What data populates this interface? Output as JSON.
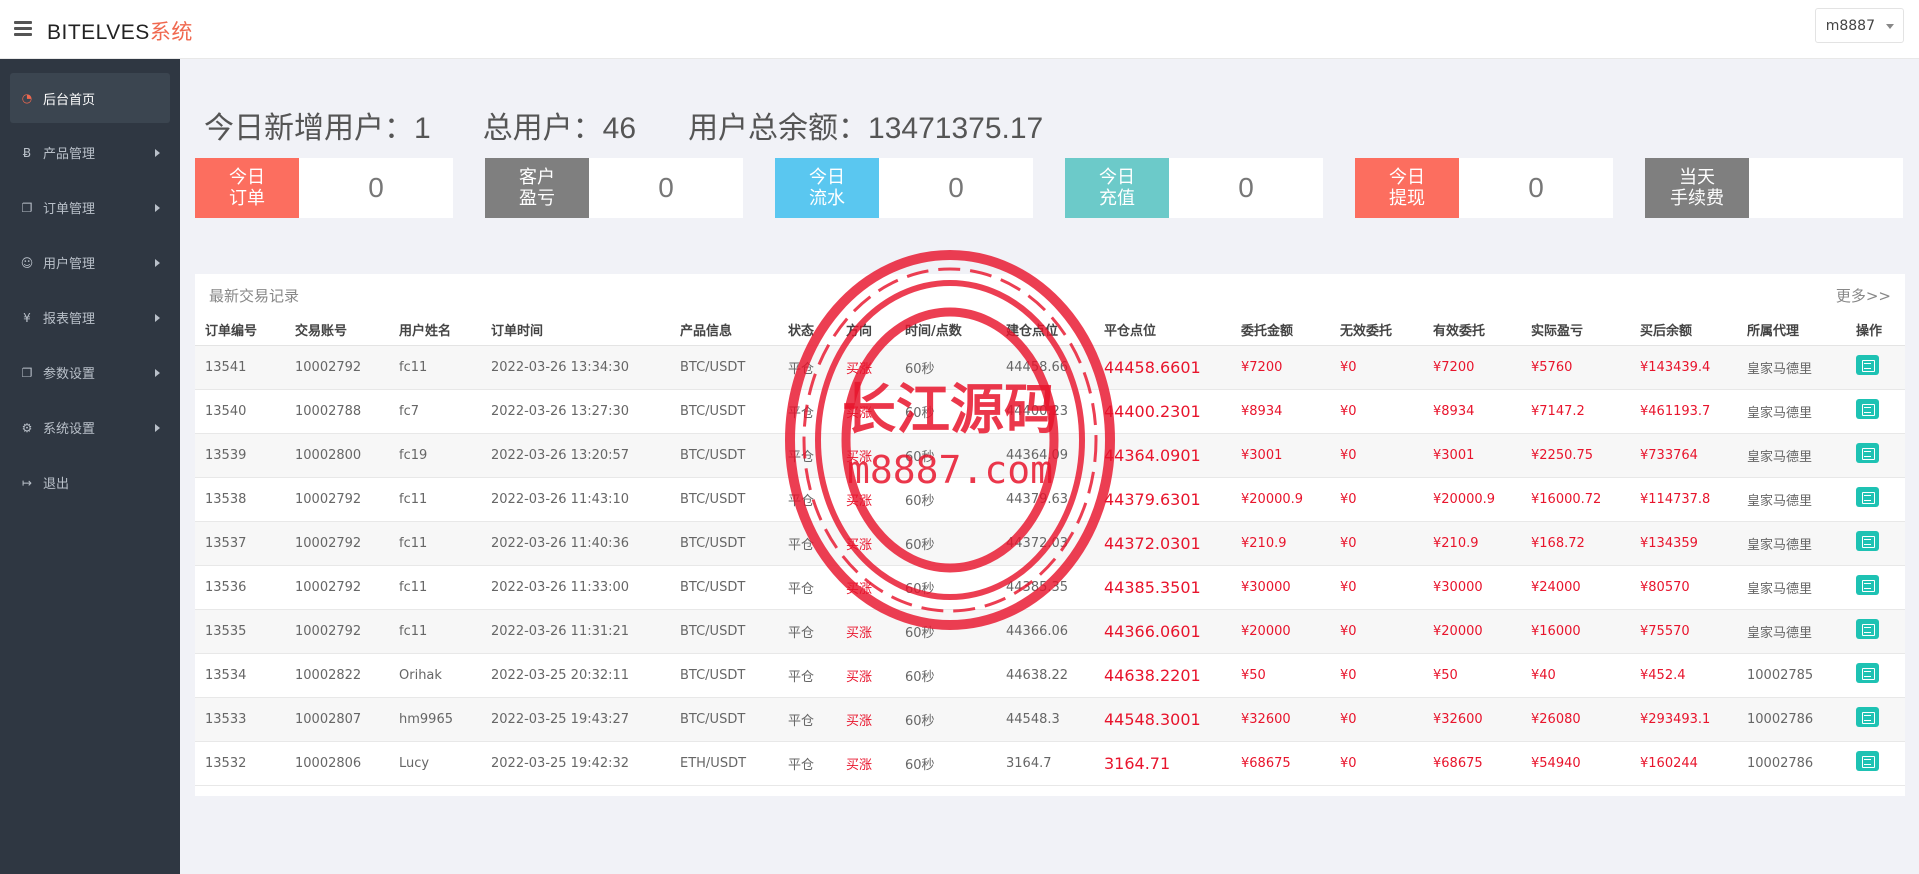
{
  "header": {
    "brand_main": "BITELVES",
    "brand_accent": "系统",
    "user": "m8887"
  },
  "sidebar": {
    "items": [
      {
        "label": "后台首页",
        "icon": "dashboard-icon",
        "active": true
      },
      {
        "label": "产品管理",
        "icon": "bitcoin-icon",
        "active": false
      },
      {
        "label": "订单管理",
        "icon": "copy-icon",
        "active": false
      },
      {
        "label": "用户管理",
        "icon": "user-icon",
        "active": false
      },
      {
        "label": "报表管理",
        "icon": "yen-icon",
        "active": false
      },
      {
        "label": "参数设置",
        "icon": "copy-icon",
        "active": false
      },
      {
        "label": "系统设置",
        "icon": "gears-icon",
        "active": false
      },
      {
        "label": "退出",
        "icon": "sign-out-icon",
        "active": false
      }
    ]
  },
  "summary": {
    "new_users": "今日新增用户：1",
    "total_users": "总用户：46",
    "total_balance": "用户总余额：13471375.17"
  },
  "stats": [
    {
      "label": "今日\n订单",
      "value": "0",
      "color": "#fc6e5f"
    },
    {
      "label": "客户\n盈亏",
      "value": "0",
      "color": "#7f7f7f"
    },
    {
      "label": "今日\n流水",
      "value": "0",
      "color": "#5ac7f0"
    },
    {
      "label": "今日\n充值",
      "value": "0",
      "color": "#6ccac9"
    },
    {
      "label": "今日\n提现",
      "value": "0",
      "color": "#fc6e5f"
    },
    {
      "label": "当天\n手续费",
      "value": "",
      "color": "#7f7f7f"
    }
  ],
  "table": {
    "title": "最新交易记录",
    "more": "更多>>",
    "columns": [
      "订单编号",
      "交易账号",
      "用户姓名",
      "订单时间",
      "产品信息",
      "状态",
      "方向",
      "时间/点数",
      "建仓点位",
      "平仓点位",
      "委托金额",
      "无效委托",
      "有效委托",
      "实际盈亏",
      "买后余额",
      "所属代理",
      "操作"
    ],
    "rows": [
      [
        "13541",
        "10002792",
        "fc11",
        "2022-03-26 13:34:30",
        "BTC/USDT",
        "平仓",
        "买涨",
        "60秒",
        "44458.66",
        "44458.6601",
        "¥7200",
        "¥0",
        "¥7200",
        "¥5760",
        "¥143439.4",
        "皇家马德里"
      ],
      [
        "13540",
        "10002788",
        "fc7",
        "2022-03-26 13:27:30",
        "BTC/USDT",
        "平仓",
        "买涨",
        "60秒",
        "44400.23",
        "44400.2301",
        "¥8934",
        "¥0",
        "¥8934",
        "¥7147.2",
        "¥461193.7",
        "皇家马德里"
      ],
      [
        "13539",
        "10002800",
        "fc19",
        "2022-03-26 13:20:57",
        "BTC/USDT",
        "平仓",
        "买涨",
        "60秒",
        "44364.09",
        "44364.0901",
        "¥3001",
        "¥0",
        "¥3001",
        "¥2250.75",
        "¥733764",
        "皇家马德里"
      ],
      [
        "13538",
        "10002792",
        "fc11",
        "2022-03-26 11:43:10",
        "BTC/USDT",
        "平仓",
        "买涨",
        "60秒",
        "44379.63",
        "44379.6301",
        "¥20000.9",
        "¥0",
        "¥20000.9",
        "¥16000.72",
        "¥114737.8",
        "皇家马德里"
      ],
      [
        "13537",
        "10002792",
        "fc11",
        "2022-03-26 11:40:36",
        "BTC/USDT",
        "平仓",
        "买涨",
        "60秒",
        "44372.03",
        "44372.0301",
        "¥210.9",
        "¥0",
        "¥210.9",
        "¥168.72",
        "¥134359",
        "皇家马德里"
      ],
      [
        "13536",
        "10002792",
        "fc11",
        "2022-03-26 11:33:00",
        "BTC/USDT",
        "平仓",
        "买涨",
        "60秒",
        "44385.35",
        "44385.3501",
        "¥30000",
        "¥0",
        "¥30000",
        "¥24000",
        "¥80570",
        "皇家马德里"
      ],
      [
        "13535",
        "10002792",
        "fc11",
        "2022-03-26 11:31:21",
        "BTC/USDT",
        "平仓",
        "买涨",
        "60秒",
        "44366.06",
        "44366.0601",
        "¥20000",
        "¥0",
        "¥20000",
        "¥16000",
        "¥75570",
        "皇家马德里"
      ],
      [
        "13534",
        "10002822",
        "Orihak",
        "2022-03-25 20:32:11",
        "BTC/USDT",
        "平仓",
        "买涨",
        "60秒",
        "44638.22",
        "44638.2201",
        "¥50",
        "¥0",
        "¥50",
        "¥40",
        "¥452.4",
        "10002785"
      ],
      [
        "13533",
        "10002807",
        "hm9965",
        "2022-03-25 19:43:27",
        "BTC/USDT",
        "平仓",
        "买涨",
        "60秒",
        "44548.3",
        "44548.3001",
        "¥32600",
        "¥0",
        "¥32600",
        "¥26080",
        "¥293493.1",
        "10002786"
      ],
      [
        "13532",
        "10002806",
        "Lucy",
        "2022-03-25 19:42:32",
        "ETH/USDT",
        "平仓",
        "买涨",
        "60秒",
        "3164.7",
        "3164.71",
        "¥68675",
        "¥0",
        "¥68675",
        "¥54940",
        "¥160244",
        "10002786"
      ]
    ]
  },
  "watermark": {
    "line1": "长江源码",
    "line2": "m8887.com",
    "color": "#e8142c"
  }
}
